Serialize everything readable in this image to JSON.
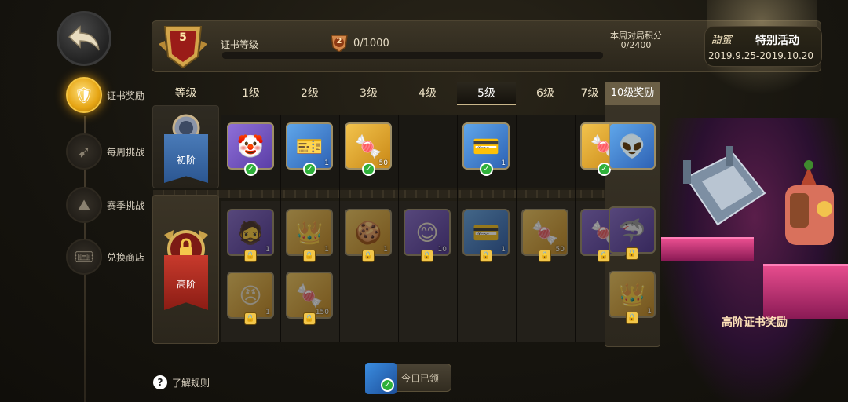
{
  "nav": {
    "back_icon": "back-arrow-icon",
    "items": [
      {
        "label": "证书奖励",
        "icon": "certificate-icon",
        "active": true
      },
      {
        "label": "每周挑战",
        "icon": "target-icon",
        "active": false
      },
      {
        "label": "赛季挑战",
        "icon": "mountain-icon",
        "active": false
      },
      {
        "label": "兑换商店",
        "icon": "ticket-icon",
        "active": false
      }
    ]
  },
  "header": {
    "level": "5",
    "cert_level_label": "证书等级",
    "small_badge_num": "2",
    "progress_text": "0/1000",
    "progress_fraction": 0,
    "weekly_points_label": "本周对局积分",
    "weekly_points_value": "0/2400"
  },
  "event": {
    "name_fancy": "甜蜜",
    "name": "特别活动",
    "dates": "2019.9.25-2019.10.20"
  },
  "table": {
    "level_header": "等级",
    "columns": [
      "1级",
      "2级",
      "3级",
      "4级",
      "5级",
      "6级",
      "7级"
    ],
    "selected_column": "5级",
    "lvl10_header": "10级奖励",
    "tiers": {
      "basic": "初阶",
      "advanced": "高阶"
    }
  },
  "rewards": {
    "basic": [
      {
        "col": 0,
        "kind": "purple",
        "glyph": "🤡",
        "qty": "",
        "state": "claimed"
      },
      {
        "col": 1,
        "kind": "blue",
        "glyph": "🎫",
        "qty": "1",
        "state": "claimed"
      },
      {
        "col": 2,
        "kind": "gold",
        "glyph": "🍬",
        "qty": "50",
        "state": "claimed"
      },
      {
        "col": 4,
        "kind": "blue",
        "glyph": "💳",
        "qty": "1",
        "state": "claimed"
      },
      {
        "col": 6,
        "kind": "gold",
        "glyph": "🍬",
        "qty": "",
        "state": "claimed"
      }
    ],
    "basic_lvl10": {
      "kind": "blue",
      "glyph": "👽",
      "qty": "",
      "state": "available"
    },
    "advanced": [
      {
        "col": 0,
        "row": 0,
        "kind": "purple",
        "glyph": "🧔",
        "qty": "1",
        "state": "locked"
      },
      {
        "col": 1,
        "row": 0,
        "kind": "gold",
        "glyph": "👑",
        "qty": "1",
        "state": "locked"
      },
      {
        "col": 2,
        "row": 0,
        "kind": "gold",
        "glyph": "🍪",
        "qty": "1",
        "state": "locked"
      },
      {
        "col": 3,
        "row": 0,
        "kind": "purple",
        "glyph": "😊",
        "qty": "10",
        "state": "locked"
      },
      {
        "col": 4,
        "row": 0,
        "kind": "blue",
        "glyph": "💳",
        "qty": "1",
        "state": "locked"
      },
      {
        "col": 5,
        "row": 0,
        "kind": "gold",
        "glyph": "🍬",
        "qty": "50",
        "state": "locked"
      },
      {
        "col": 6,
        "row": 0,
        "kind": "purple",
        "glyph": "🍬",
        "qty": "",
        "state": "locked"
      },
      {
        "col": 0,
        "row": 1,
        "kind": "gold",
        "glyph": "😠",
        "qty": "1",
        "state": "locked"
      },
      {
        "col": 1,
        "row": 1,
        "kind": "gold",
        "glyph": "🍬",
        "qty": "150",
        "state": "locked"
      }
    ],
    "advanced_lvl10": [
      {
        "kind": "purple",
        "glyph": "🦈",
        "qty": "",
        "state": "locked"
      },
      {
        "kind": "gold",
        "glyph": "👑",
        "qty": "1",
        "state": "locked"
      }
    ]
  },
  "showcase": {
    "title": "高阶证书奖励"
  },
  "footer": {
    "rules_label": "了解规则",
    "claim_label": "今日已领"
  },
  "colors": {
    "gold": "#e6a514",
    "claimed": "#2fb03a",
    "basic_ribbon": "#2b5691",
    "adv_ribbon": "#8a1c14"
  }
}
